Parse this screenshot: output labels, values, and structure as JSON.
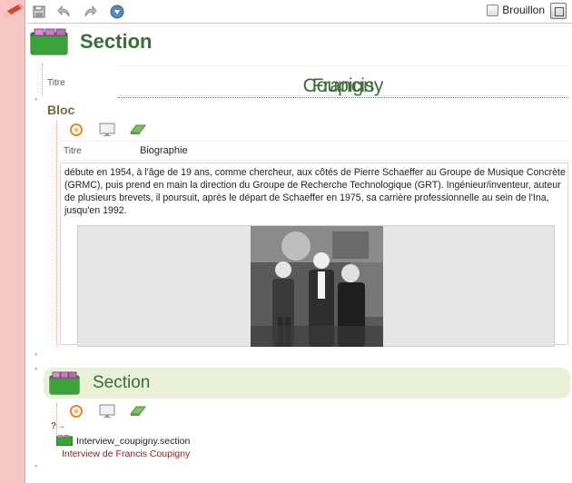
{
  "toolbar": {
    "draft_label": "Brouillon"
  },
  "section1": {
    "title": "Section",
    "titre_label": "Titre",
    "titre_value_a": "Francis ",
    "titre_value_b": "Coupigny"
  },
  "bloc": {
    "label": "Bloc",
    "titre_label": "Titre",
    "titre_value": "Biographie",
    "paragraph": "débute en 1954, à l'âge de 19 ans, comme chercheur, aux côtés de Pierre Schaeffer au Groupe de Musique Concrète (GRMC), puis prend en main la direction du Groupe de Recherche Technologique (GRT). Ingénieur/inventeur, auteur de plusieurs brevets, il poursuit, après le départ de Schaeffer en 1975, sa carrière professionnelle au sein de l'Ina, jusqu'en 1992."
  },
  "section2": {
    "title": "Section",
    "ref_marker": "?→",
    "ref_file": "Interview_coupigny.section",
    "ref_title": "Interview de Francis Coupigny"
  },
  "margin": {
    "marker": "*"
  },
  "colors": {
    "section_green": "#3d6b3a",
    "margin_pink": "#f4c6c6",
    "section2_bg": "#e9f1d6",
    "ref_red": "#8b1f1f"
  },
  "icons": [
    "pencil-icon",
    "save-icon",
    "undo-icon",
    "redo-icon",
    "info-icon",
    "window-toggle-icon",
    "folder-icon",
    "bloc-cycle-icon",
    "monitor-icon",
    "book-icon"
  ]
}
